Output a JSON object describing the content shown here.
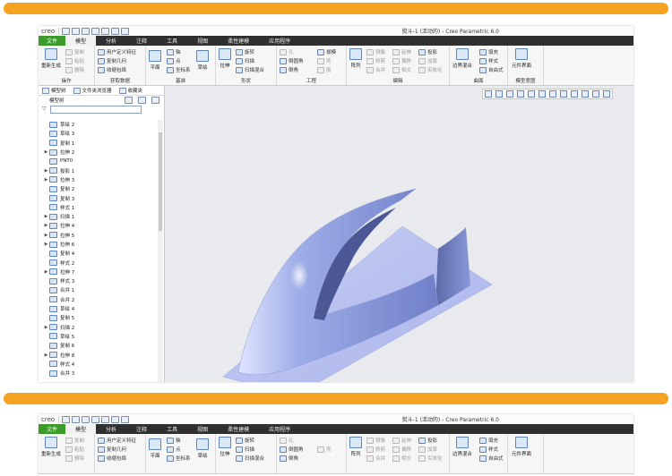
{
  "window": {
    "title": "熨斗-1 (活动的) - Creo Parametric 6.0",
    "logo": "creo"
  },
  "tabs": [
    "文件",
    "模型",
    "分析",
    "注释",
    "工具",
    "视图",
    "柔性建模",
    "应用程序"
  ],
  "ribbon": {
    "operations": {
      "label": "操作",
      "regen": "重新生成",
      "copy": "复制",
      "paste": "粘贴",
      "delete": "删除"
    },
    "get_data": {
      "label": "获取数据",
      "udf": "用户定义特征",
      "copy_geom": "复制几何",
      "shrinkwrap": "收缩包络"
    },
    "datum": {
      "label": "基准",
      "plane": "平面",
      "axis": "轴",
      "point": "点",
      "csys": "坐标系",
      "sketch": "草绘"
    },
    "shapes": {
      "label": "形状",
      "extrude": "拉伸",
      "revolve": "旋转",
      "sweep": "扫描",
      "swept_blend": "扫描混合"
    },
    "engineering": {
      "label": "工程",
      "hole": "孔",
      "round": "倒圆角",
      "chamfer": "倒角",
      "draft": "拔模",
      "shell": "壳",
      "rib": "筋"
    },
    "editing": {
      "label": "编辑",
      "pattern": "阵列",
      "mirror": "镜像",
      "trim": "修剪",
      "merge": "合并",
      "extend": "延伸",
      "offset": "偏移",
      "intersect": "相交",
      "project": "投影",
      "thicken": "加厚",
      "solidify": "实体化"
    },
    "surfaces": {
      "label": "曲面",
      "boundary_blend": "边界混合",
      "fill": "填充",
      "style": "样式",
      "freestyle": "自由式"
    },
    "model_intent": {
      "label": "模型意图",
      "component_interface": "元件界面"
    }
  },
  "ribbon2": {
    "regen": "重新生成",
    "copy": "复制",
    "paste": "粘贴",
    "delete": "删除",
    "udf": "用户定义特征",
    "copy_geom": "复制几何",
    "shrinkwrap": "收缩包络",
    "plane": "平面",
    "axis": "轴",
    "point": "点",
    "csys": "坐标系",
    "sketch": "草绘",
    "extrude": "拉伸",
    "revolve": "旋转",
    "sweep": "扫描",
    "swept_blend": "扫描混合",
    "hole": "孔",
    "round": "倒圆角",
    "chamfer": "倒角",
    "shell": "壳",
    "pattern": "阵列",
    "mirror": "镜像",
    "trim": "修剪",
    "merge": "合并",
    "intersect": "相交",
    "extend": "延伸",
    "offset": "偏移",
    "project": "投影",
    "thicken": "加厚",
    "solidify": "实体化",
    "boundary_blend": "边界混合",
    "fill": "填充",
    "style": "样式",
    "freestyle": "自由式",
    "component_interface": "元件界面"
  },
  "panel": {
    "tabs": [
      "模型树",
      "文件夹浏览器",
      "收藏夹"
    ],
    "header": "模型树"
  },
  "tree": [
    {
      "label": "草绘 2",
      "exp": false
    },
    {
      "label": "草绘 3",
      "exp": false
    },
    {
      "label": "复制 1",
      "exp": false
    },
    {
      "label": "拉伸 2",
      "exp": true
    },
    {
      "label": "PNT0",
      "exp": false
    },
    {
      "label": "投影 1",
      "exp": true
    },
    {
      "label": "拉伸 3",
      "exp": true
    },
    {
      "label": "复制 2",
      "exp": false
    },
    {
      "label": "复制 3",
      "exp": false
    },
    {
      "label": "样式 1",
      "exp": false
    },
    {
      "label": "扫描 1",
      "exp": true
    },
    {
      "label": "拉伸 4",
      "exp": true
    },
    {
      "label": "拉伸 5",
      "exp": true
    },
    {
      "label": "拉伸 6",
      "exp": true
    },
    {
      "label": "复制 4",
      "exp": false
    },
    {
      "label": "样式 2",
      "exp": false
    },
    {
      "label": "拉伸 7",
      "exp": true
    },
    {
      "label": "样式 3",
      "exp": false
    },
    {
      "label": "合并 1",
      "exp": false
    },
    {
      "label": "合并 2",
      "exp": false
    },
    {
      "label": "草绘 4",
      "exp": false
    },
    {
      "label": "复制 5",
      "exp": false
    },
    {
      "label": "扫描 2",
      "exp": true
    },
    {
      "label": "草绘 5",
      "exp": false
    },
    {
      "label": "复制 6",
      "exp": false
    },
    {
      "label": "拉伸 8",
      "exp": true
    },
    {
      "label": "样式 4",
      "exp": false
    },
    {
      "label": "合并 3",
      "exp": false
    }
  ],
  "colors": {
    "accent_bar": "#f4a21f",
    "file_tab": "#3c9a2a",
    "surface": "#9aa8e6"
  }
}
